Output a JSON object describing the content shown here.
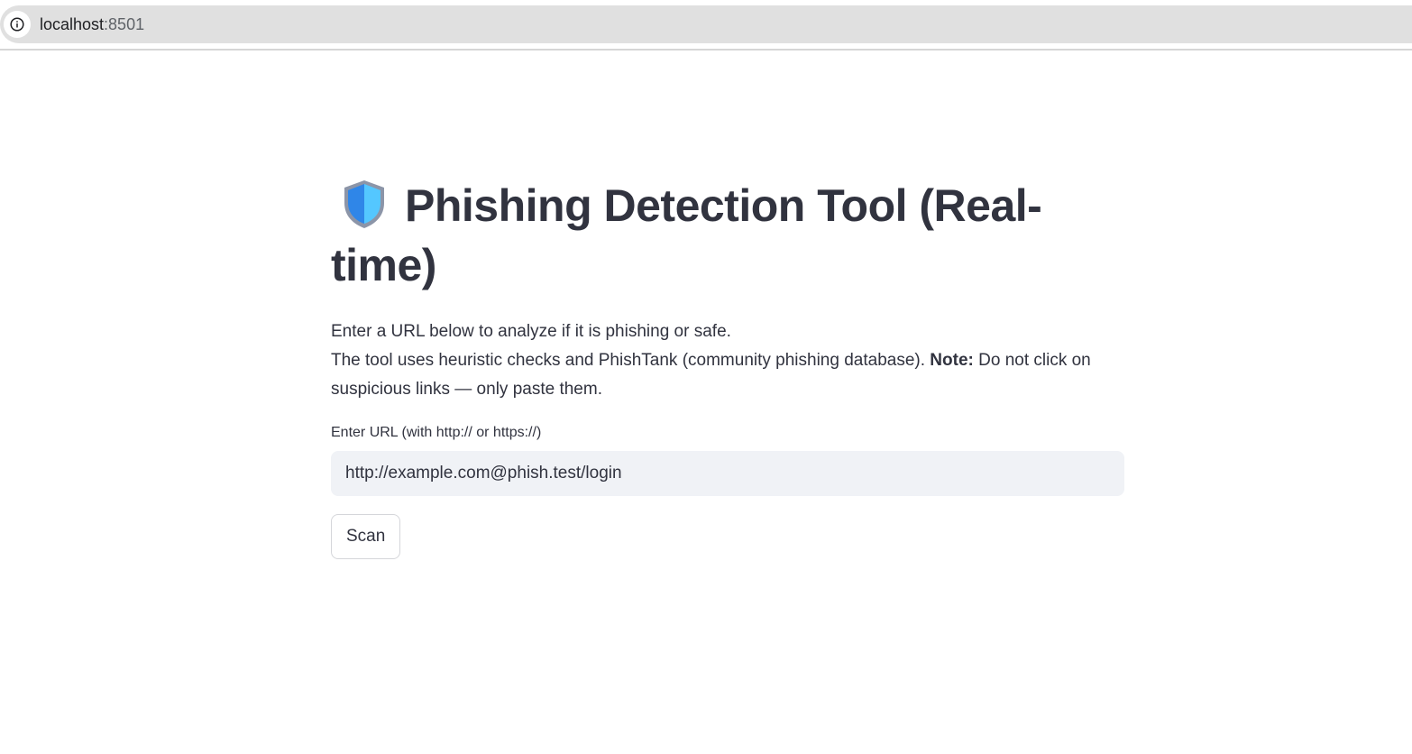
{
  "browser": {
    "url_host": "localhost",
    "url_port": ":8501",
    "info_icon": "info-icon"
  },
  "page": {
    "title_icon": "shield-icon",
    "title": "Phishing Detection Tool (Real-time)",
    "description_line1": "Enter a URL below to analyze if it is phishing or safe.",
    "description_line2_part1": "The tool uses heuristic checks and PhishTank (community phishing database). ",
    "description_note_label": "Note:",
    "description_line2_part2": " Do not click on suspicious links — only paste them.",
    "input_label": "Enter URL (with http:// or https://)",
    "input_value": "http://example.com@phish.test/login",
    "scan_button_label": "Scan"
  }
}
